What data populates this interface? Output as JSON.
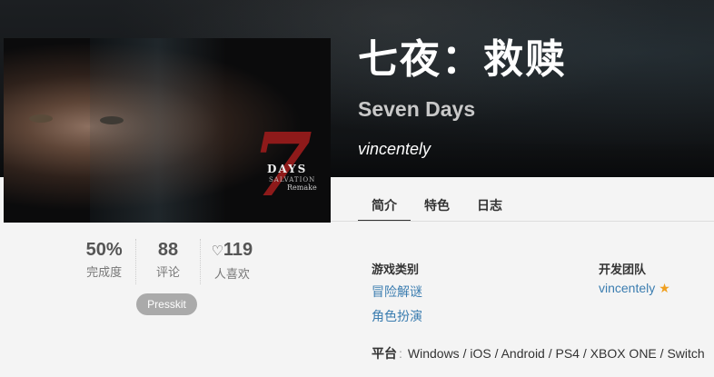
{
  "game": {
    "title_cn": "七夜：救赎",
    "title_en": "Seven Days",
    "author": "vincentely"
  },
  "cover": {
    "logo_number": "7",
    "logo_days": "DAYS",
    "logo_subtitle": "SALVATION",
    "logo_remake": "Remake"
  },
  "tabs": [
    {
      "label": "简介"
    },
    {
      "label": "特色"
    },
    {
      "label": "日志"
    }
  ],
  "stats": {
    "completion_value": "50%",
    "completion_label": "完成度",
    "reviews_value": "88",
    "reviews_label": "评论",
    "likes_value": "119",
    "likes_label": "人喜欢"
  },
  "presskit_label": "Presskit",
  "genre": {
    "heading": "游戏类别",
    "items": [
      "冒险解谜",
      "角色扮演"
    ]
  },
  "team": {
    "heading": "开发团队",
    "member": "vincentely"
  },
  "platforms": {
    "label": "平台",
    "separator": ":",
    "list": "Windows / iOS / Android / PS4 / XBOX ONE / Switch"
  },
  "colors": {
    "link": "#3b7db0",
    "star": "#f0a020",
    "logo_red": "#8e1a1a"
  }
}
